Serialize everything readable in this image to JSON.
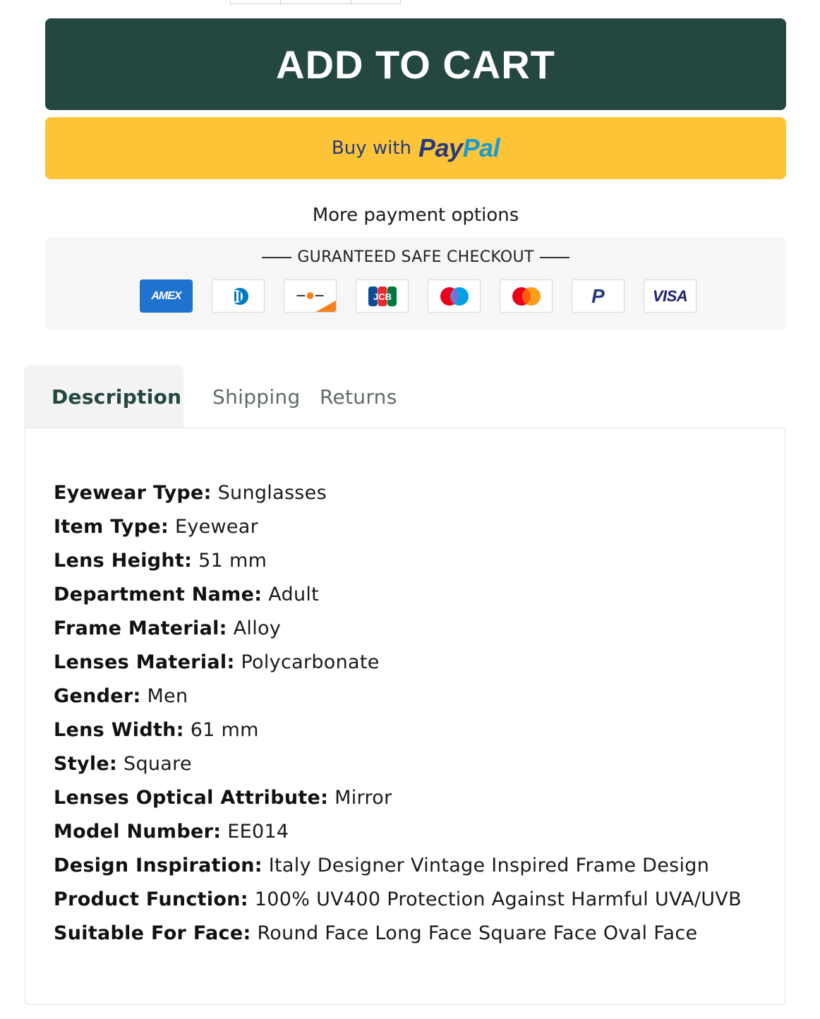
{
  "actions": {
    "add_to_cart": "ADD TO CART",
    "paypal_prefix": "Buy with",
    "paypal_brand_pay": "Pay",
    "paypal_brand_pal": "Pal",
    "more_payment_options": "More payment options"
  },
  "checkout": {
    "title": "GURANTEED SAFE CHECKOUT",
    "methods": [
      {
        "icon": "amex-icon",
        "label": "AMEX"
      },
      {
        "icon": "diners-club-icon",
        "label": ""
      },
      {
        "icon": "discover-icon",
        "label": ""
      },
      {
        "icon": "jcb-icon",
        "label": "JCB"
      },
      {
        "icon": "maestro-icon",
        "label": ""
      },
      {
        "icon": "mastercard-icon",
        "label": ""
      },
      {
        "icon": "paypal-icon",
        "label": "P"
      },
      {
        "icon": "visa-icon",
        "label": "VISA"
      }
    ]
  },
  "tabs": [
    {
      "label": "Description",
      "active": true
    },
    {
      "label": "Shipping",
      "active": false
    },
    {
      "label": "Returns",
      "active": false
    }
  ],
  "description": {
    "specs": [
      {
        "key": "Eyewear Type:",
        "value": "Sunglasses"
      },
      {
        "key": "Item Type:",
        "value": "Eyewear"
      },
      {
        "key": "Lens Height:",
        "value": "51 mm"
      },
      {
        "key": "Department Name:",
        "value": "Adult"
      },
      {
        "key": "Frame Material:",
        "value": "Alloy"
      },
      {
        "key": "Lenses Material:",
        "value": "Polycarbonate"
      },
      {
        "key": "Gender:",
        "value": "Men"
      },
      {
        "key": "Lens Width:",
        "value": "61 mm"
      },
      {
        "key": "Style:",
        "value": "Square"
      },
      {
        "key": "Lenses Optical Attribute:",
        "value": "Mirror"
      },
      {
        "key": "Model Number:",
        "value": "EE014"
      },
      {
        "key": "Design Inspiration:",
        "value": "Italy Designer Vintage Inspired Frame Design"
      },
      {
        "key": "Product Function:",
        "value": "100% UV400 Protection Against Harmful UVA/UVB"
      },
      {
        "key": "Suitable For Face:",
        "value": "Round Face Long Face Square Face Oval Face"
      }
    ]
  },
  "colors": {
    "primary": "#244841",
    "paypal_yellow": "#fdc438",
    "paypal_navy": "#253b80",
    "paypal_blue": "#179bd7"
  }
}
